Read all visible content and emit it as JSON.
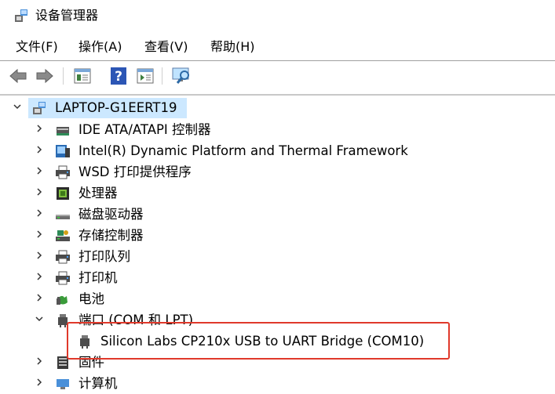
{
  "window": {
    "title": "设备管理器",
    "icon": "device-manager-icon"
  },
  "menu": [
    "文件(F)",
    "操作(A)",
    "查看(V)",
    "帮助(H)"
  ],
  "toolbar": [
    "back-arrow-icon",
    "forward-arrow-icon",
    "properties-icon",
    "help-icon",
    "show-panel-icon",
    "scan-hardware-icon"
  ],
  "tree": {
    "root": {
      "label": "LAPTOP-G1EERT19",
      "icon": "computer-icon",
      "expanded": true
    },
    "items": [
      {
        "label": "IDE ATA/ATAPI 控制器",
        "icon": "ide-controller-icon"
      },
      {
        "label": "Intel(R) Dynamic Platform and Thermal Framework",
        "icon": "thermal-framework-icon"
      },
      {
        "label": "WSD 打印提供程序",
        "icon": "printer-icon"
      },
      {
        "label": "处理器",
        "icon": "processor-icon"
      },
      {
        "label": "磁盘驱动器",
        "icon": "disk-drive-icon"
      },
      {
        "label": "存储控制器",
        "icon": "storage-controller-icon"
      },
      {
        "label": "打印队列",
        "icon": "printer-icon"
      },
      {
        "label": "打印机",
        "icon": "printer-icon"
      },
      {
        "label": "电池",
        "icon": "battery-icon"
      },
      {
        "label": "端口 (COM 和 LPT)",
        "icon": "port-icon",
        "expanded": true
      },
      {
        "label": "Silicon Labs CP210x USB to UART Bridge (COM10)",
        "icon": "port-icon",
        "child": true
      },
      {
        "label": "固件",
        "icon": "firmware-icon"
      },
      {
        "label": "计算机",
        "icon": "computer-icon"
      }
    ]
  },
  "colors": {
    "selection": "#cce8ff",
    "highlight_border": "#e0392b"
  }
}
